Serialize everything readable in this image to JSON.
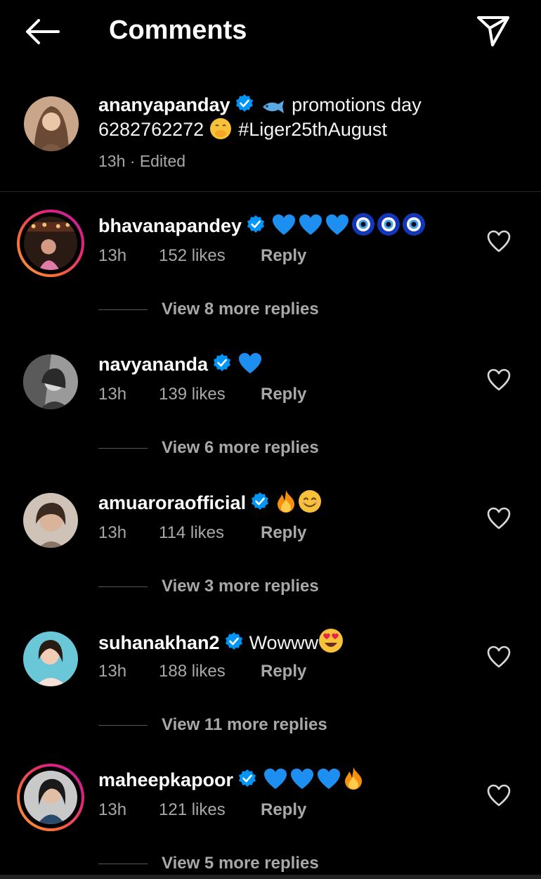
{
  "header": {
    "title": "Comments"
  },
  "caption": {
    "username": "ananyapanday",
    "text_part1": "promotions day",
    "text_part2": "6282762272",
    "hashtag": "#Liger25thAugust",
    "meta": "13h · Edited"
  },
  "comments": [
    {
      "username": "bhavanapandey",
      "text": "",
      "emojis": [
        "blue-heart",
        "blue-heart",
        "blue-heart",
        "nazar-amulet",
        "nazar-amulet",
        "nazar-amulet"
      ],
      "time": "13h",
      "likes": "152 likes",
      "reply": "Reply",
      "view_more": "View 8 more replies",
      "story_ring": true
    },
    {
      "username": "navyananda",
      "text": "",
      "emojis": [
        "blue-heart"
      ],
      "time": "13h",
      "likes": "139 likes",
      "reply": "Reply",
      "view_more": "View 6 more replies",
      "story_ring": false
    },
    {
      "username": "amuaroraofficial",
      "text": "",
      "emojis": [
        "fire",
        "smiling-face"
      ],
      "time": "13h",
      "likes": "114 likes",
      "reply": "Reply",
      "view_more": "View 3 more replies",
      "story_ring": false
    },
    {
      "username": "suhanakhan2",
      "text": "Wowww",
      "emojis": [
        "heart-eyes"
      ],
      "time": "13h",
      "likes": "188 likes",
      "reply": "Reply",
      "view_more": "View 11 more replies",
      "story_ring": false
    },
    {
      "username": "maheepkapoor",
      "text": "",
      "emojis": [
        "blue-heart",
        "blue-heart",
        "blue-heart",
        "fire"
      ],
      "time": "13h",
      "likes": "121 likes",
      "reply": "Reply",
      "view_more": "View 5 more replies",
      "story_ring": true
    }
  ],
  "colors": {
    "background": "#000000",
    "verified": "#0095f6",
    "secondary_text": "#a8a8a8"
  }
}
